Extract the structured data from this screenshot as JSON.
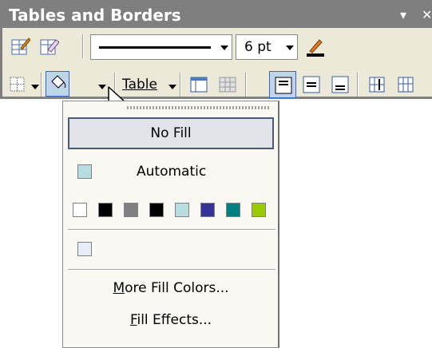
{
  "toolbar": {
    "title": "Tables and Borders",
    "title_controls": [
      "▾",
      "✕"
    ],
    "line_weight": "6 pt",
    "table_menu_label": "Table"
  },
  "fill_menu": {
    "no_fill_label": "No Fill",
    "automatic_label": "Automatic",
    "automatic_color": "#b7dde2",
    "swatches": [
      "#ffffff",
      "#000000",
      "#808080",
      "#000000",
      "#b7dde2",
      "#333399",
      "#008080",
      "#99cc00"
    ],
    "recent_color": "#e9edf7",
    "more_colors": {
      "mnemonic": "M",
      "rest": "ore Fill Colors..."
    },
    "fill_effects": {
      "mnemonic": "F",
      "rest": "ill Effects..."
    }
  }
}
